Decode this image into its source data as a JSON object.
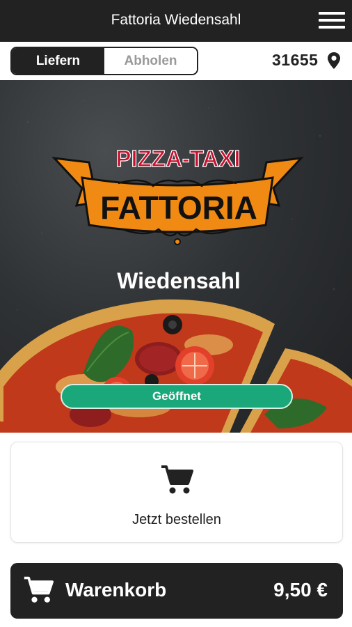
{
  "header": {
    "title": "Fattoria Wiedensahl",
    "menu_icon": "hamburger-menu-icon"
  },
  "delivery": {
    "options": [
      "Liefern",
      "Abholen"
    ],
    "selected": "Liefern",
    "zip_code": "31655",
    "location_icon": "map-pin-icon"
  },
  "hero": {
    "logo_top_text": "PIZZA-TAXI",
    "logo_banner_text": "FATTORIA",
    "logo_subtitle": "Wiedensahl",
    "status": "Geöffnet",
    "status_color": "#1aa77a",
    "logo_colors": {
      "banner": "#f08a12",
      "red_text": "#c8102e"
    }
  },
  "order": {
    "label": "Jetzt bestellen",
    "icon": "cart-icon"
  },
  "cart": {
    "label": "Warenkorb",
    "total": "9,50 €",
    "icon": "cart-icon"
  }
}
